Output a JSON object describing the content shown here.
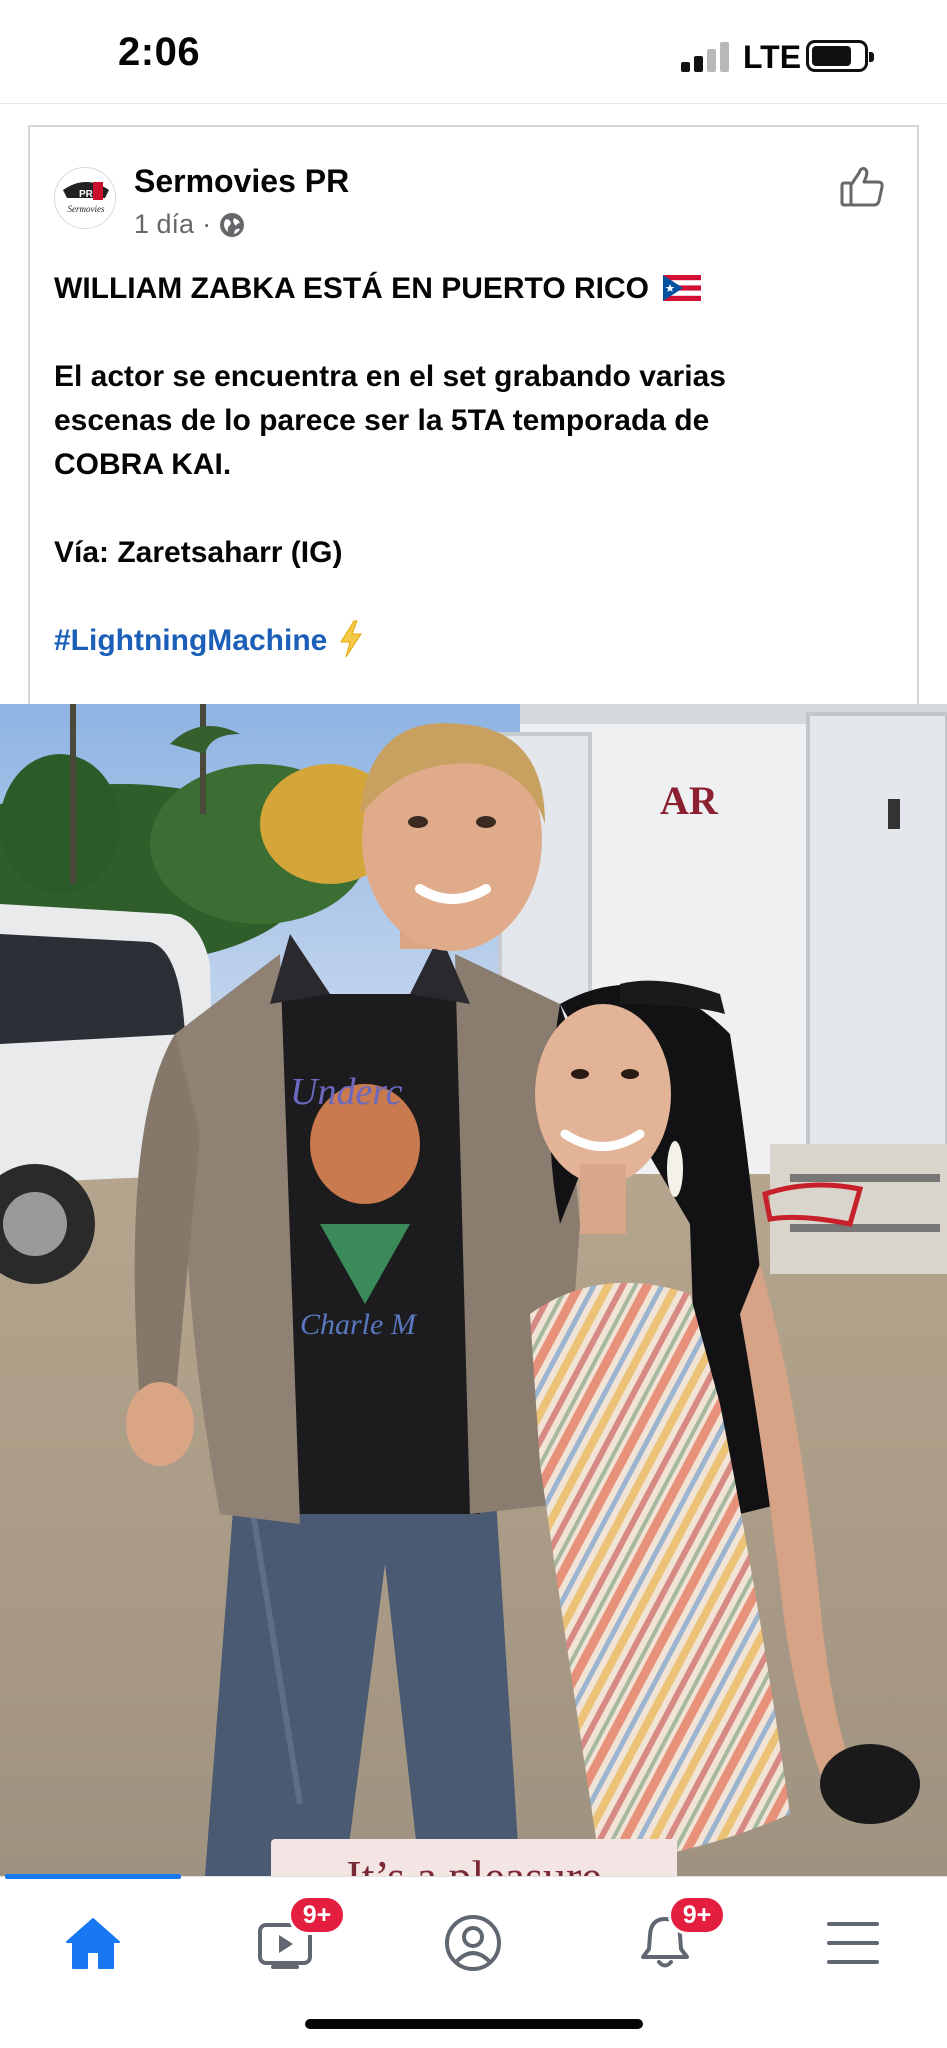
{
  "status_bar": {
    "time": "2:06",
    "network": "LTE",
    "battery_level": 0.75
  },
  "post": {
    "page_name": "Sermovies PR",
    "age": "1 día",
    "meta_separator": "·",
    "avatar_text": "PR",
    "avatar_subtext": "Sermovies",
    "headline": "WILLIAM ZABKA ESTÁ EN PUERTO RICO",
    "body_line1": "El actor se encuentra en el set grabando varias",
    "body_line2": "escenas de lo parece ser la 5TA temporada de",
    "body_line3": "COBRA KAI.",
    "source": "Vía: Zaretsaharr (IG)",
    "hashtag": "#LightningMachine",
    "photo_caption": "It’s a pleasure",
    "trailer_logo": "AR"
  },
  "tab_bar": {
    "tabs": [
      {
        "name": "home",
        "icon": "home-icon",
        "active": true
      },
      {
        "name": "watch",
        "icon": "video-icon",
        "badge": "9+"
      },
      {
        "name": "profile",
        "icon": "profile-icon"
      },
      {
        "name": "notifications",
        "icon": "bell-icon",
        "badge": "9+"
      },
      {
        "name": "menu",
        "icon": "hamburger-menu-icon"
      }
    ]
  },
  "colors": {
    "accent": "#1877f2",
    "hashtag": "#1b5fb8",
    "badge": "#e41e3f",
    "meta_text": "#65676b",
    "tab_icon": "#606770"
  }
}
